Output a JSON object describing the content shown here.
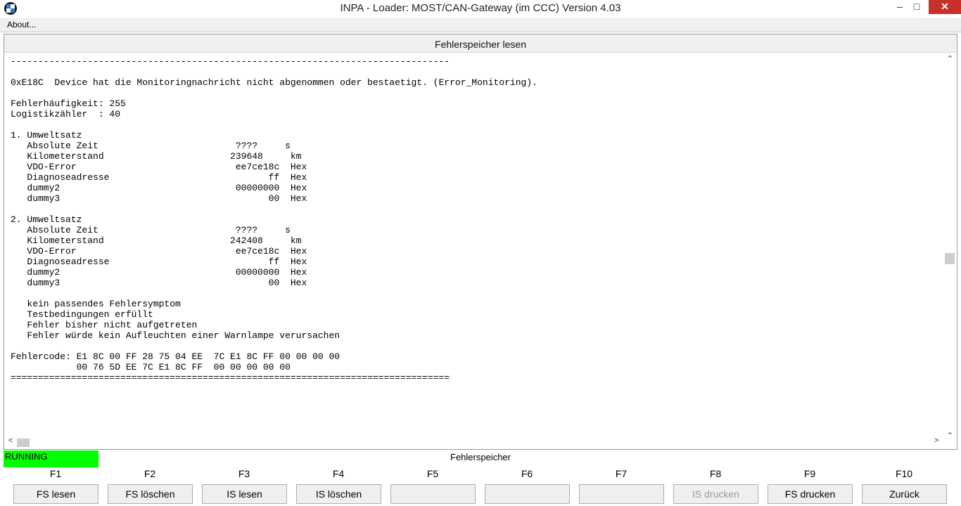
{
  "window": {
    "title": "INPA - Loader:  MOST/CAN-Gateway (im CCC) Version 4.03",
    "minimize_glyph": "–",
    "maximize_glyph": "□",
    "close_glyph": "✕"
  },
  "menu": {
    "about": "About..."
  },
  "panel": {
    "title": "Fehlerspeicher lesen"
  },
  "output_lines": [
    "--------------------------------------------------------------------------------",
    "",
    "0xE18C  Device hat die Monitoringnachricht nicht abgenommen oder bestaetigt. (Error_Monitoring).",
    "",
    "Fehlerhäufigkeit: 255",
    "Logistikzähler  : 40",
    "",
    "1. Umweltsatz",
    "   Absolute Zeit                         ????     s",
    "   Kilometerstand                       239648     km",
    "   VDO-Error                             ee7ce18c  Hex",
    "   Diagnoseadresse                             ff  Hex",
    "   dummy2                                00000000  Hex",
    "   dummy3                                      00  Hex",
    "",
    "2. Umweltsatz",
    "   Absolute Zeit                         ????     s",
    "   Kilometerstand                       242408     km",
    "   VDO-Error                             ee7ce18c  Hex",
    "   Diagnoseadresse                             ff  Hex",
    "   dummy2                                00000000  Hex",
    "   dummy3                                      00  Hex",
    "",
    "   kein passendes Fehlersymptom",
    "   Testbedingungen erfüllt",
    "   Fehler bisher nicht aufgetreten",
    "   Fehler würde kein Aufleuchten einer Warnlampe verursachen",
    "",
    "Fehlercode: E1 8C 00 FF 28 75 04 EE  7C E1 8C FF 00 00 00 00",
    "            00 76 5D EE 7C E1 8C FF  00 00 00 00 00",
    "================================================================================"
  ],
  "status": {
    "state": "RUNNING",
    "title": "Fehlerspeicher",
    "state_color": "#00ff00"
  },
  "fkeys": [
    {
      "key": "F1",
      "label": "FS lesen",
      "enabled": true
    },
    {
      "key": "F2",
      "label": "FS löschen",
      "enabled": true
    },
    {
      "key": "F3",
      "label": "IS lesen",
      "enabled": true
    },
    {
      "key": "F4",
      "label": "IS löschen",
      "enabled": true
    },
    {
      "key": "F5",
      "label": "",
      "enabled": true
    },
    {
      "key": "F6",
      "label": "",
      "enabled": true
    },
    {
      "key": "F7",
      "label": "",
      "enabled": true
    },
    {
      "key": "F8",
      "label": "IS drucken",
      "enabled": false
    },
    {
      "key": "F9",
      "label": "FS drucken",
      "enabled": true
    },
    {
      "key": "F10",
      "label": "Zurück",
      "enabled": true
    }
  ]
}
